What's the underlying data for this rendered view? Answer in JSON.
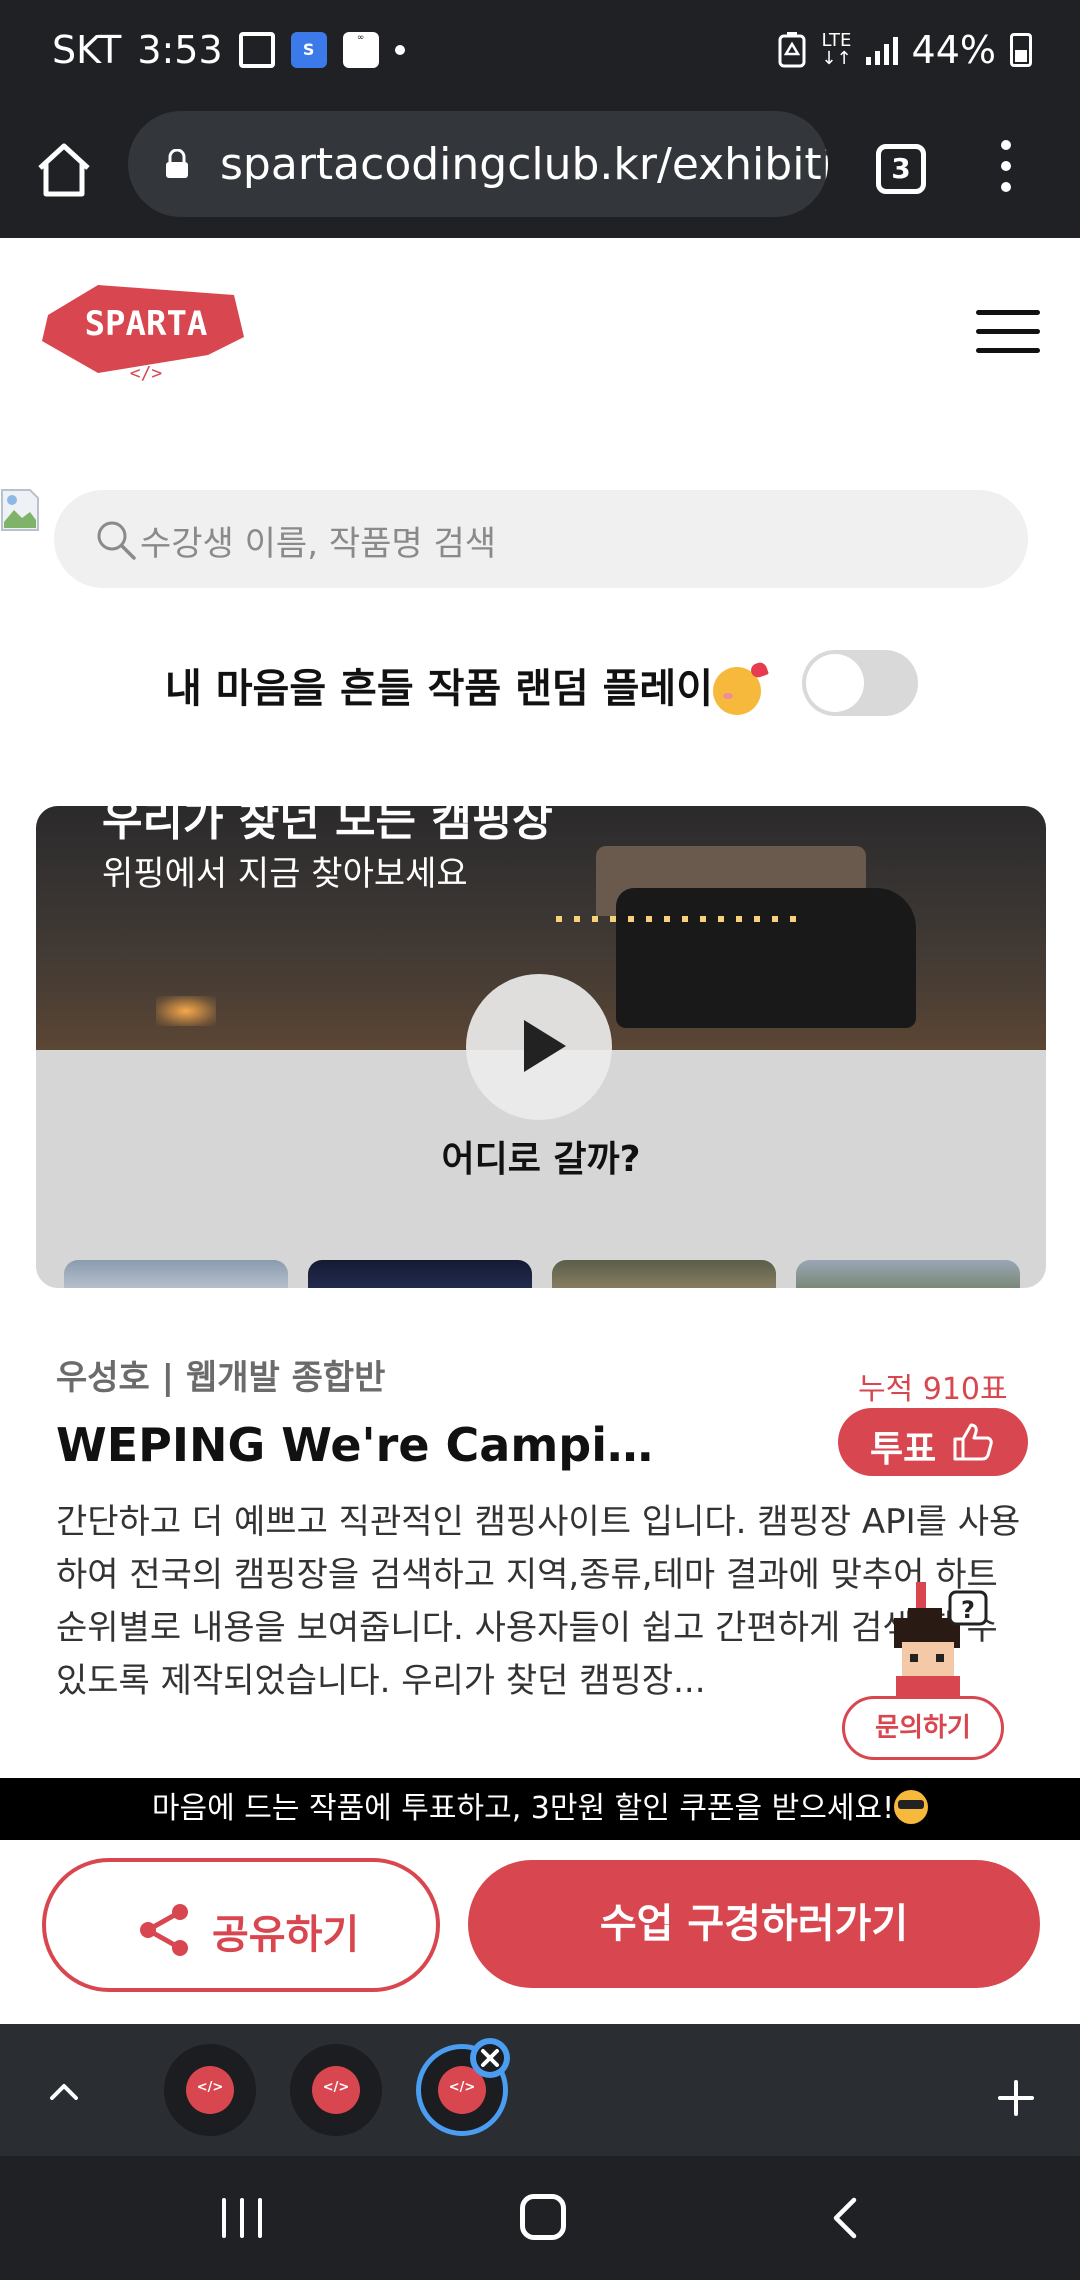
{
  "status_bar": {
    "carrier": "SKT",
    "time": "3:53",
    "app_icon_sol": "SOL",
    "app_icon_genesis": "GENESIS",
    "network": "LTE",
    "battery": "44%"
  },
  "browser": {
    "url": "spartacodingclub.kr/exhibitic",
    "tab_count": "3"
  },
  "header": {
    "logo_text": "SPARTA"
  },
  "search": {
    "placeholder": "수강생 이름, 작품명 검색"
  },
  "random_play": {
    "label": "내 마음을 흔들 작품 랜덤 플레이",
    "enabled": false
  },
  "media": {
    "heading": "우리가 찾던 모든 캠핑장",
    "subheading": "위핑에서 지금 찾아보세요",
    "caption": "어디로 갈까?"
  },
  "project": {
    "author": "우성호 | 웹개발 종합반",
    "vote_count": "누적 910표",
    "vote_label": "투표",
    "title": "WEPING We're Campi…",
    "description": "간단하고 더 예쁘고 직관적인 캠핑사이트 입니다. 캠핑장 API를 사용하여 전국의 캠핑장을 검색하고 지역,종류,테마 결과에 맞추어 하트 순위별로 내용을 보여줍니다. 사용자들이 쉽고 간편하게 검색 할 수 있도록 제작되었습니다. 우리가 찾던 캠핑장..."
  },
  "inquiry_label": "문의하기",
  "banner": {
    "text": "마음에 드는 작품에 투표하고, 3만원 할인 쿠폰을 받으세요!"
  },
  "actions": {
    "share_label": "공유하기",
    "class_label": "수업 구경하러가기"
  },
  "colors": {
    "accent": "#d8474f",
    "dark_chrome": "#1f2125"
  }
}
